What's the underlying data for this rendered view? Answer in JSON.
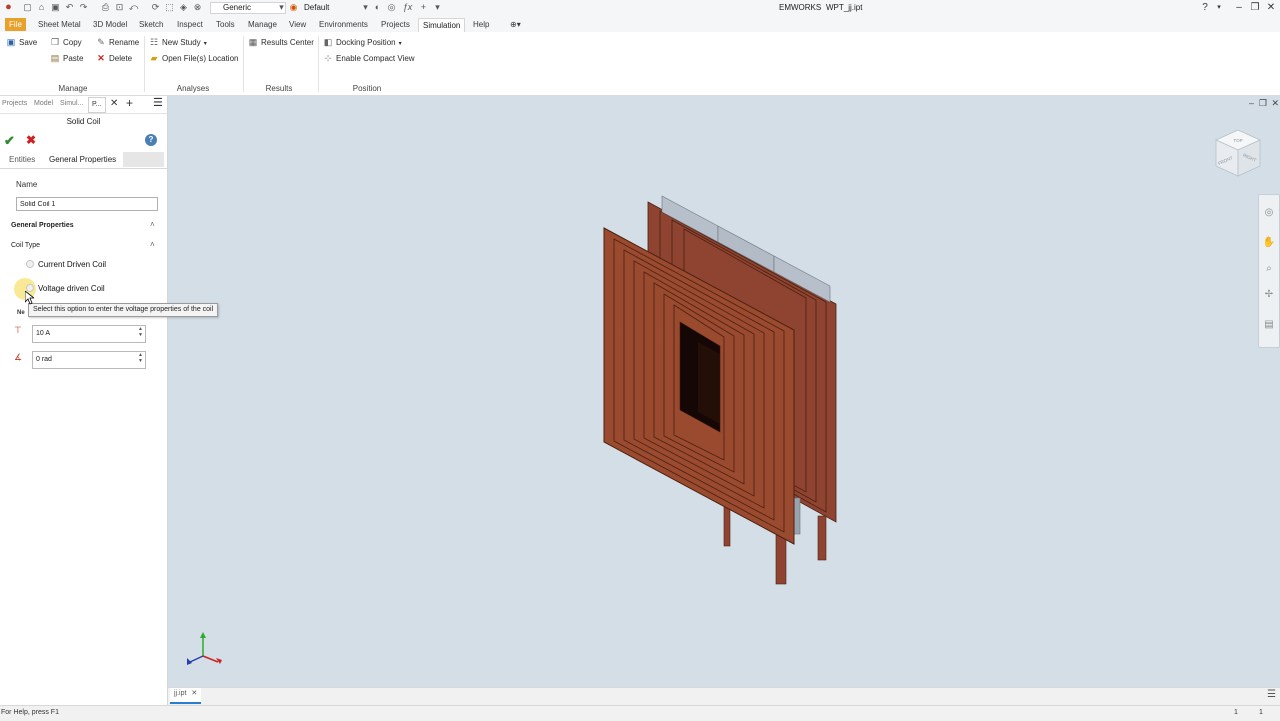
{
  "titlebar": {
    "style_select": "Generic",
    "appearance_select": "Default",
    "app_name": "EMWORKS",
    "file_name": "WPT_jj.ipt"
  },
  "menu": {
    "tabs": [
      "File",
      "Sheet Metal",
      "3D Model",
      "Sketch",
      "Inspect",
      "Tools",
      "Manage",
      "View",
      "Environments",
      "Projects",
      "Simulation",
      "Help"
    ]
  },
  "ribbon": {
    "save": "Save",
    "copy": "Copy",
    "paste": "Paste",
    "rename": "Rename",
    "delete": "Delete",
    "new_study": "New Study",
    "open_location": "Open File(s) Location",
    "results_center": "Results Center",
    "docking_position": "Docking Position",
    "compact_view": "Enable Compact View",
    "groups": {
      "manage": "Manage",
      "analyses": "Analyses",
      "results": "Results",
      "position": "Position"
    }
  },
  "panel": {
    "tabs": [
      "Projects",
      "Model",
      "Simul...",
      "P..."
    ],
    "title": "Solid Coil",
    "subtabs": {
      "entities": "Entities",
      "general": "General Properties"
    },
    "name_label": "Name",
    "name_value": "Solid Coil 1",
    "section_title": "General Properties",
    "coil_type_label": "Coil Type",
    "option_current": "Current Driven Coil",
    "option_voltage": "Voltage driven Coil",
    "tooltip": "Select this option to enter the voltage properties of the coil",
    "hidden_label_partial": "Ne",
    "current_value": "10 A",
    "phase_value": "0 rad"
  },
  "document_tab": "jj.ipt",
  "status": {
    "help_text": "For Help, press F1",
    "count_a": "1",
    "count_b": "1"
  },
  "view_cube": {
    "top": "TOP",
    "front": "FRONT",
    "right": "RIGHT"
  },
  "colors": {
    "copper": "#9a4a2e",
    "copper_dark": "#5e2a18",
    "viewport_bg": "#d4dee6",
    "accent_green": "#2e8b2e",
    "accent_red": "#cc2222",
    "file_tab": "#e8a12a"
  }
}
